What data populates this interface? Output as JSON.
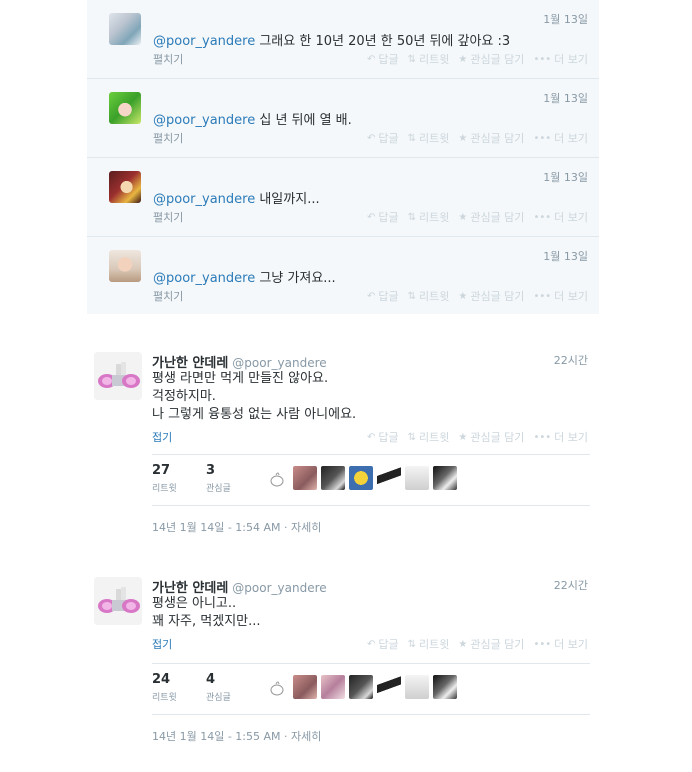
{
  "colors": {
    "link": "#2b7bb9",
    "muted": "#8899a6",
    "action": "#ccd6dd",
    "reply_bg": "#f5f8fa"
  },
  "actions": {
    "reply": "답글",
    "retweet": "리트윗",
    "favorite": "관심글 담기",
    "more": "더 보기"
  },
  "replies": [
    {
      "avatar": "anime-girl-silver-avatar",
      "time": "1월 13일",
      "mention": "@poor_yandere",
      "text": " 그래요 한 10년 20년 한 50년 뒤에 갚아요 :3",
      "expand": "펼치기"
    },
    {
      "avatar": "anime-girl-green-avatar",
      "time": "1월 13일",
      "mention": "@poor_yandere",
      "text": " 십 년 뒤에 열 배.",
      "expand": "펼치기"
    },
    {
      "avatar": "anime-girl-blonde-avatar",
      "time": "1월 13일",
      "mention": "@poor_yandere",
      "text": " 내일까지...",
      "expand": "펼치기"
    },
    {
      "avatar": "child-photo-avatar",
      "time": "1월 13일",
      "mention": "@poor_yandere",
      "text": " 그냥 가져요...",
      "expand": "펼치기"
    }
  ],
  "tweets": [
    {
      "name": "가난한 얀데레",
      "handle": "@poor_yandere",
      "time": "22시간",
      "lines": [
        "평생 라면만 먹게 만들진 않아요.",
        "걱정하지마.",
        "나 그렇게 융통성 없는 사람 아니에요."
      ],
      "fold": "접기",
      "retweets": "27",
      "retweets_label": "리트윗",
      "favorites": "3",
      "favorites_label": "관심글",
      "date": "14년 1월 14일 - 1:54 AM · 자세히"
    },
    {
      "name": "가난한 얀데레",
      "handle": "@poor_yandere",
      "time": "22시간",
      "lines": [
        "평생은 아니고..",
        "꽤 자주, 먹겠지만..."
      ],
      "fold": "접기",
      "retweets": "24",
      "retweets_label": "리트윗",
      "favorites": "4",
      "favorites_label": "관심글",
      "date": "14년 1월 14일 - 1:55 AM · 자세히"
    }
  ]
}
